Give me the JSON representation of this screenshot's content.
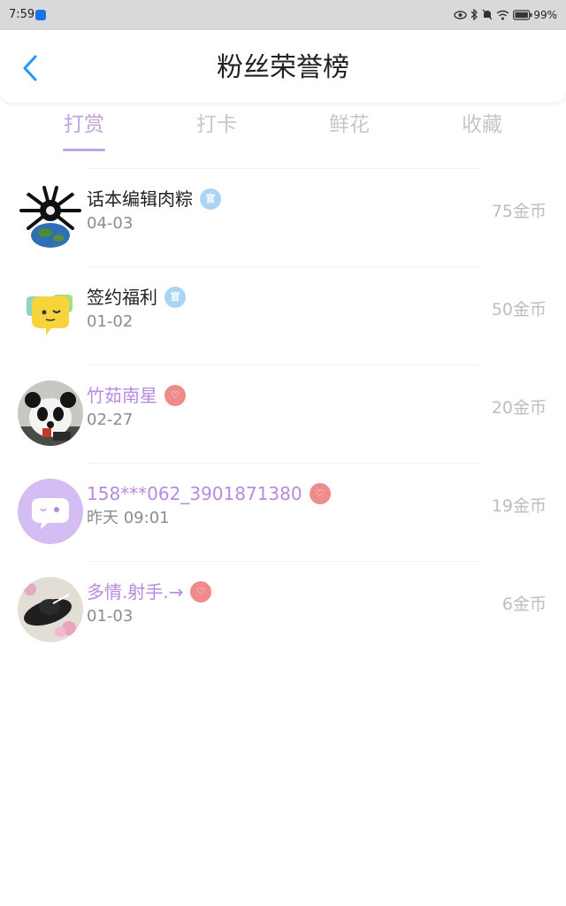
{
  "status_bar": {
    "time": "7:59",
    "battery": "99%"
  },
  "header": {
    "title": "粉丝荣誉榜"
  },
  "tabs": [
    {
      "label": "打赏"
    },
    {
      "label": "打卡"
    },
    {
      "label": "鲜花"
    },
    {
      "label": "收藏"
    }
  ],
  "active_tab": "打赏",
  "colors": {
    "accent": "#c2a3df",
    "vip_name": "#b98be0",
    "official_badge": "#a9d4f5",
    "heart_badge": "#ef8b8b",
    "back_arrow": "#2196f3"
  },
  "list": [
    {
      "name": "话本编辑肉粽",
      "date": "04-03",
      "amount": "75金币",
      "badge": "official",
      "badge_text": "官",
      "name_style": "normal",
      "avatar": "spider-globe"
    },
    {
      "name": "签约福利",
      "date": "01-02",
      "amount": "50金币",
      "badge": "official",
      "badge_text": "官",
      "name_style": "normal",
      "avatar": "chat-bubble-yellow"
    },
    {
      "name": "竹茹南星",
      "date": "02-27",
      "amount": "20金币",
      "badge": "heart",
      "badge_text": "♡",
      "name_style": "vip",
      "avatar": "panda"
    },
    {
      "name": "158***062_3901871380",
      "date": "昨天 09:01",
      "amount": "19金币",
      "badge": "heart",
      "badge_text": "♡",
      "name_style": "vip",
      "avatar": "chat-bubble-purple"
    },
    {
      "name": "多情.射手.→",
      "date": "01-03",
      "amount": "6金币",
      "badge": "heart",
      "badge_text": "♡",
      "name_style": "vip",
      "avatar": "hat-flowers"
    }
  ]
}
